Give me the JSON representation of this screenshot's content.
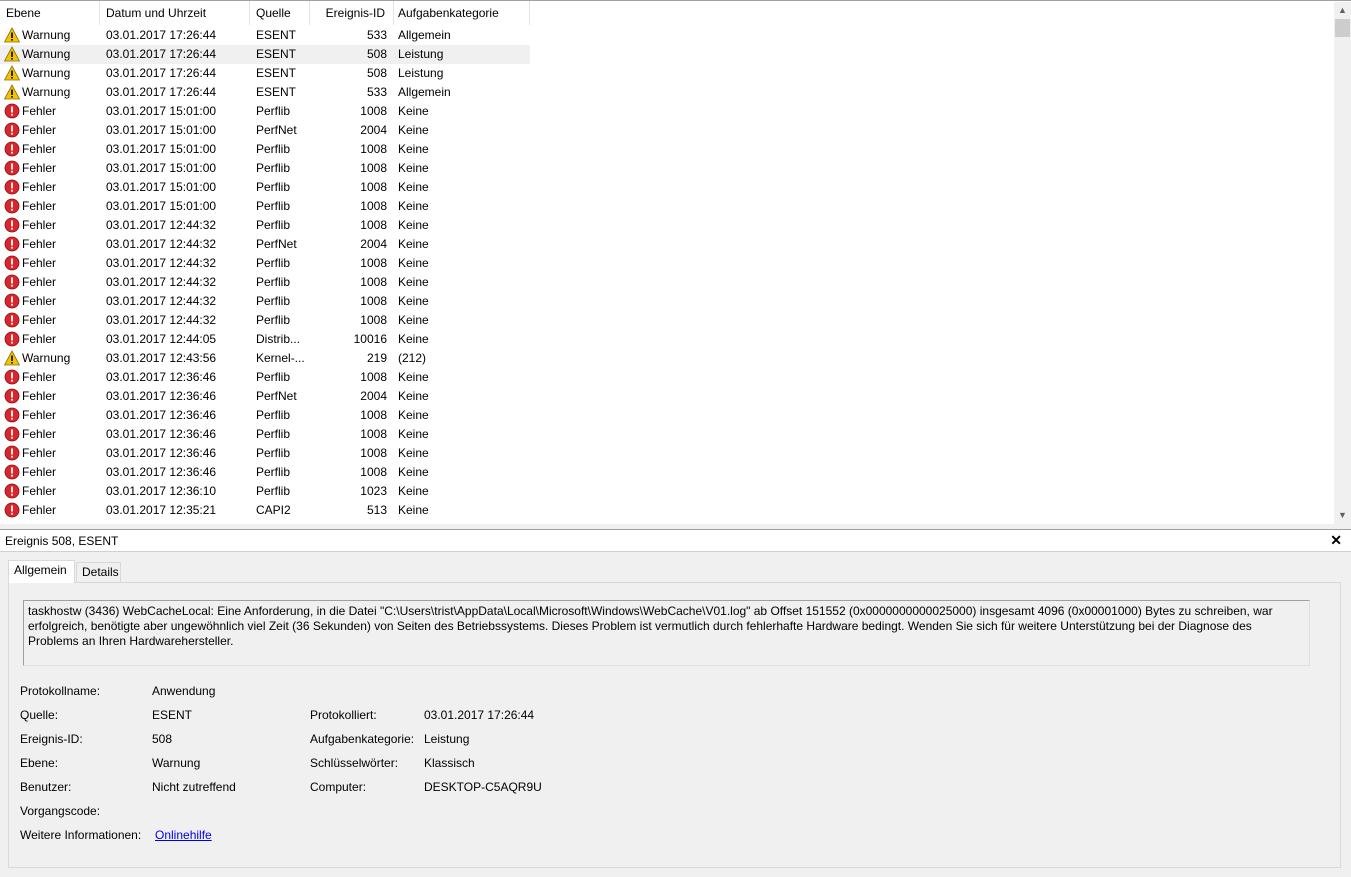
{
  "list": {
    "columns": {
      "level": "Ebene",
      "date": "Datum und Uhrzeit",
      "source": "Quelle",
      "id": "Ereignis-ID",
      "category": "Aufgabenkategorie"
    },
    "rows": [
      {
        "level": "Warnung",
        "type": "warning",
        "date": "03.01.2017 17:26:44",
        "source": "ESENT",
        "id": "533",
        "category": "Allgemein"
      },
      {
        "level": "Warnung",
        "type": "warning",
        "date": "03.01.2017 17:26:44",
        "source": "ESENT",
        "id": "508",
        "category": "Leistung",
        "selected": true
      },
      {
        "level": "Warnung",
        "type": "warning",
        "date": "03.01.2017 17:26:44",
        "source": "ESENT",
        "id": "508",
        "category": "Leistung"
      },
      {
        "level": "Warnung",
        "type": "warning",
        "date": "03.01.2017 17:26:44",
        "source": "ESENT",
        "id": "533",
        "category": "Allgemein"
      },
      {
        "level": "Fehler",
        "type": "error",
        "date": "03.01.2017 15:01:00",
        "source": "Perflib",
        "id": "1008",
        "category": "Keine"
      },
      {
        "level": "Fehler",
        "type": "error",
        "date": "03.01.2017 15:01:00",
        "source": "PerfNet",
        "id": "2004",
        "category": "Keine"
      },
      {
        "level": "Fehler",
        "type": "error",
        "date": "03.01.2017 15:01:00",
        "source": "Perflib",
        "id": "1008",
        "category": "Keine"
      },
      {
        "level": "Fehler",
        "type": "error",
        "date": "03.01.2017 15:01:00",
        "source": "Perflib",
        "id": "1008",
        "category": "Keine"
      },
      {
        "level": "Fehler",
        "type": "error",
        "date": "03.01.2017 15:01:00",
        "source": "Perflib",
        "id": "1008",
        "category": "Keine"
      },
      {
        "level": "Fehler",
        "type": "error",
        "date": "03.01.2017 15:01:00",
        "source": "Perflib",
        "id": "1008",
        "category": "Keine"
      },
      {
        "level": "Fehler",
        "type": "error",
        "date": "03.01.2017 12:44:32",
        "source": "Perflib",
        "id": "1008",
        "category": "Keine"
      },
      {
        "level": "Fehler",
        "type": "error",
        "date": "03.01.2017 12:44:32",
        "source": "PerfNet",
        "id": "2004",
        "category": "Keine"
      },
      {
        "level": "Fehler",
        "type": "error",
        "date": "03.01.2017 12:44:32",
        "source": "Perflib",
        "id": "1008",
        "category": "Keine"
      },
      {
        "level": "Fehler",
        "type": "error",
        "date": "03.01.2017 12:44:32",
        "source": "Perflib",
        "id": "1008",
        "category": "Keine"
      },
      {
        "level": "Fehler",
        "type": "error",
        "date": "03.01.2017 12:44:32",
        "source": "Perflib",
        "id": "1008",
        "category": "Keine"
      },
      {
        "level": "Fehler",
        "type": "error",
        "date": "03.01.2017 12:44:32",
        "source": "Perflib",
        "id": "1008",
        "category": "Keine"
      },
      {
        "level": "Fehler",
        "type": "error",
        "date": "03.01.2017 12:44:05",
        "source": "Distrib...",
        "id": "10016",
        "category": "Keine"
      },
      {
        "level": "Warnung",
        "type": "warning",
        "date": "03.01.2017 12:43:56",
        "source": "Kernel-...",
        "id": "219",
        "category": "(212)"
      },
      {
        "level": "Fehler",
        "type": "error",
        "date": "03.01.2017 12:36:46",
        "source": "Perflib",
        "id": "1008",
        "category": "Keine"
      },
      {
        "level": "Fehler",
        "type": "error",
        "date": "03.01.2017 12:36:46",
        "source": "PerfNet",
        "id": "2004",
        "category": "Keine"
      },
      {
        "level": "Fehler",
        "type": "error",
        "date": "03.01.2017 12:36:46",
        "source": "Perflib",
        "id": "1008",
        "category": "Keine"
      },
      {
        "level": "Fehler",
        "type": "error",
        "date": "03.01.2017 12:36:46",
        "source": "Perflib",
        "id": "1008",
        "category": "Keine"
      },
      {
        "level": "Fehler",
        "type": "error",
        "date": "03.01.2017 12:36:46",
        "source": "Perflib",
        "id": "1008",
        "category": "Keine"
      },
      {
        "level": "Fehler",
        "type": "error",
        "date": "03.01.2017 12:36:46",
        "source": "Perflib",
        "id": "1008",
        "category": "Keine"
      },
      {
        "level": "Fehler",
        "type": "error",
        "date": "03.01.2017 12:36:10",
        "source": "Perflib",
        "id": "1023",
        "category": "Keine"
      },
      {
        "level": "Fehler",
        "type": "error",
        "date": "03.01.2017 12:35:21",
        "source": "CAPI2",
        "id": "513",
        "category": "Keine"
      }
    ],
    "icons": {
      "warning": "warning-icon",
      "error": "error-icon"
    },
    "colors": {
      "warning_fill": "#f5c400",
      "error_fill": "#d8262c",
      "selected_row": "#f0f0f0"
    }
  },
  "detail": {
    "title": "Ereignis 508, ESENT",
    "close": "✕",
    "tabs": [
      {
        "label": "Allgemein",
        "active": true
      },
      {
        "label": "Details",
        "active": false
      }
    ],
    "description": "taskhostw (3436) WebCacheLocal: Eine Anforderung, in die Datei \"C:\\Users\\trist\\AppData\\Local\\Microsoft\\Windows\\WebCache\\V01.log\" ab Offset 151552 (0x0000000000025000) insgesamt 4096 (0x00001000) Bytes zu schreiben, war erfolgreich, benötigte aber ungewöhnlich viel Zeit (36 Sekunden) von Seiten des Betriebssystems. Dieses Problem ist vermutlich durch fehlerhafte Hardware bedingt. Wenden Sie sich für weitere Unterstützung bei der Diagnose des Problems an Ihren Hardwarehersteller.",
    "fields": {
      "log_name_label": "Protokollname:",
      "log_name": "Anwendung",
      "source_label": "Quelle:",
      "source": "ESENT",
      "logged_label": "Protokolliert:",
      "logged": "03.01.2017 17:26:44",
      "event_id_label": "Ereignis-ID:",
      "event_id": "508",
      "task_cat_label": "Aufgabenkategorie:",
      "task_cat": "Leistung",
      "level_label": "Ebene:",
      "level": "Warnung",
      "keywords_label": "Schlüsselwörter:",
      "keywords": "Klassisch",
      "user_label": "Benutzer:",
      "user": "Nicht zutreffend",
      "computer_label": "Computer:",
      "computer": "DESKTOP-C5AQR9U",
      "opcode_label": "Vorgangscode:",
      "more_info_label": "Weitere Informationen:",
      "more_info_link": "Onlinehilfe"
    },
    "colors": {
      "link": "#0000ee"
    }
  },
  "scrollbar": {
    "up": "▲",
    "down": "▼"
  }
}
